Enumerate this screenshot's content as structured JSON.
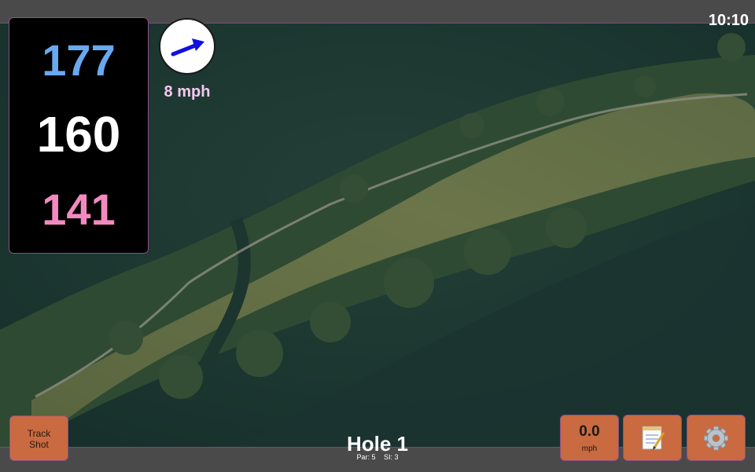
{
  "status_bar": {
    "time": "10:10"
  },
  "yardage": {
    "back": "177",
    "middle": "160",
    "front": "141"
  },
  "wind": {
    "speed": "8 mph",
    "arrow_icon": "wind-arrow-icon",
    "arrow_color": "#1010e0"
  },
  "track_shot": {
    "label_line1": "Track",
    "label_line2": "Shot"
  },
  "speed_readout": {
    "value": "0.0",
    "unit": "mph"
  },
  "notes_button": {
    "icon": "notepad-icon"
  },
  "settings_button": {
    "icon": "gear-icon"
  },
  "hole": {
    "title": "Hole 1",
    "par": "Par: 5",
    "si": "SI: 3"
  },
  "colors": {
    "back": "#6aa8f0",
    "middle": "#ffffff",
    "front": "#f28ac0",
    "button": "#c96a40",
    "accent_border": "#8a4f88"
  }
}
